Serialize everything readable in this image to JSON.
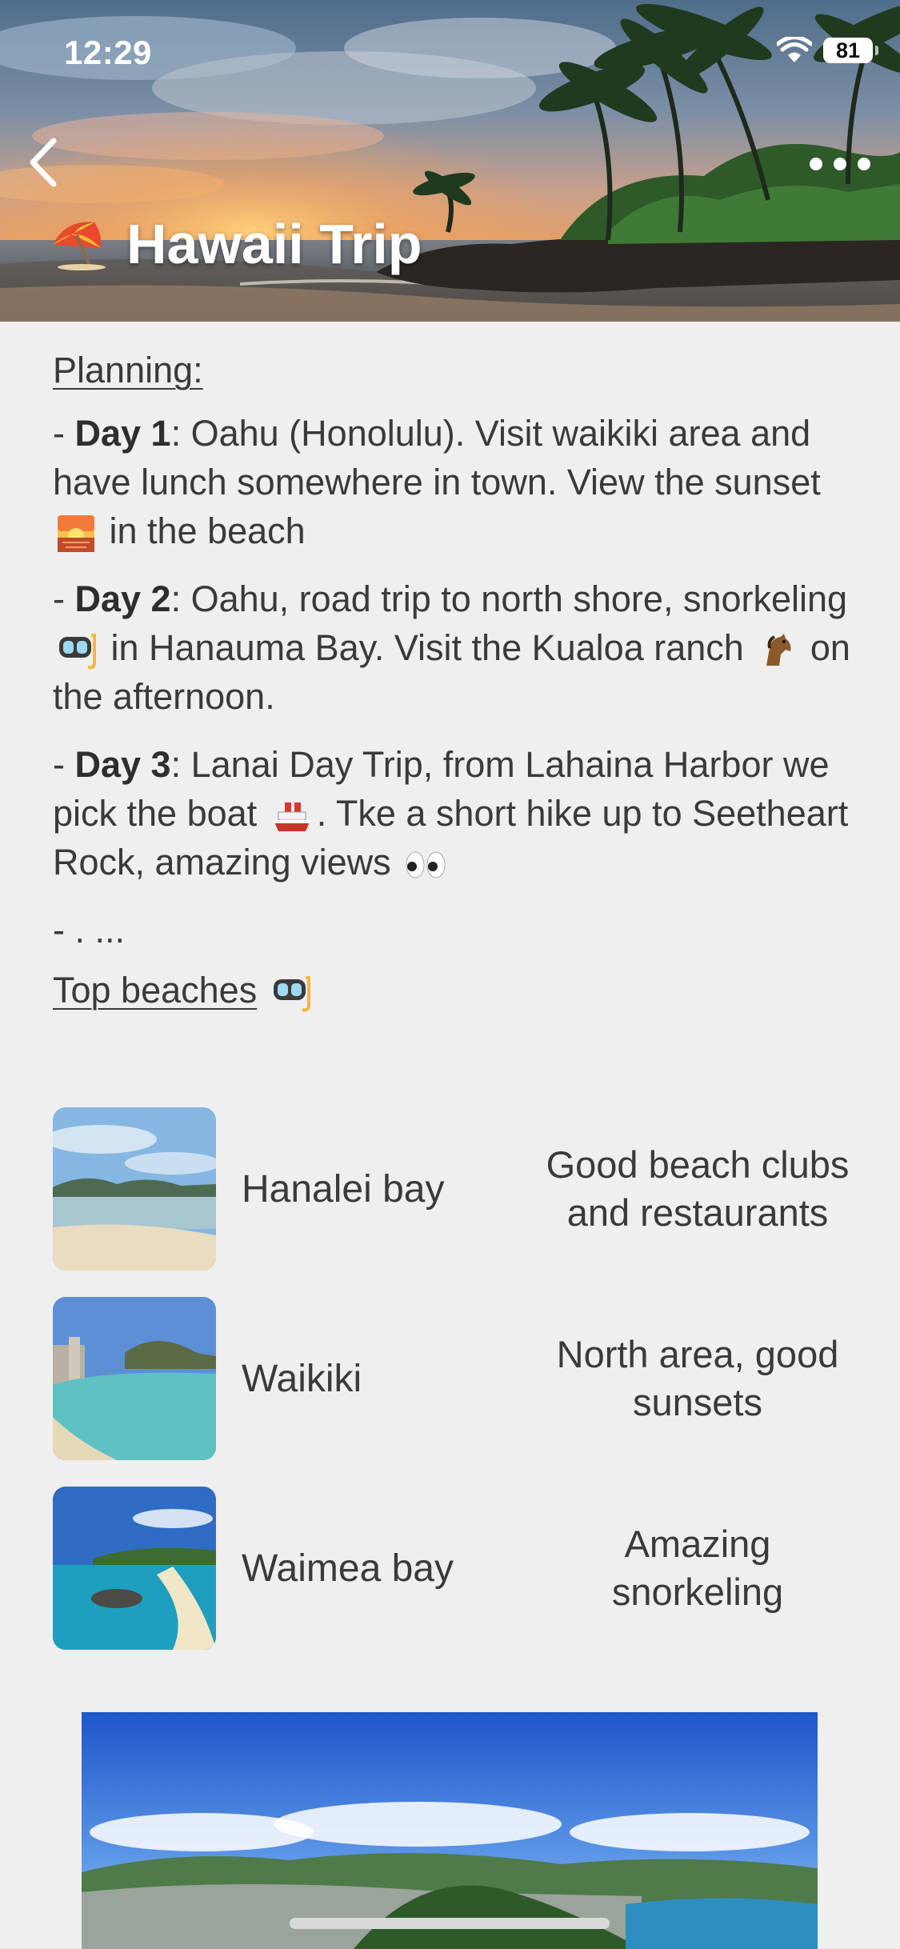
{
  "status_bar": {
    "time": "12:29",
    "battery": "81"
  },
  "header": {
    "title_emoji_icon": "umbrella-on-ground-icon",
    "title": "Hawaii Trip"
  },
  "planning": {
    "heading": "Planning:",
    "days": [
      {
        "prefix": "- ",
        "label": "Day 1",
        "text_a": ": Oahu (Honolulu). Visit waikiki  area and have lunch somewhere in town. View the sunset",
        "emoji_a": "sunset-icon",
        "text_b": " in the beach",
        "emoji_b": "",
        "text_c": ""
      },
      {
        "prefix": "- ",
        "label": "Day 2",
        "text_a": ": Oahu, road trip to north shore, snorkeling",
        "emoji_a": "diving-mask-icon",
        "text_b": " in Hanauma Bay. Visit the Kualoa ranch",
        "emoji_b": "horse-icon",
        "text_c": " on the afternoon."
      },
      {
        "prefix": "- ",
        "label": "Day 3",
        "text_a": ": Lanai Day Trip, from Lahaina Harbor we pick the boat",
        "emoji_a": "ship-icon",
        "text_b": ". Tke a short hike up to Seetheart Rock, amazing views",
        "emoji_b": "eyes-icon",
        "text_c": ""
      }
    ],
    "ellipsis_line": "-  . ..."
  },
  "beaches": {
    "heading": "Top beaches",
    "heading_icon": "diving-mask-icon",
    "rows": [
      {
        "name": "Hanalei bay",
        "note": "Good beach clubs and restaurants"
      },
      {
        "name": "Waikiki",
        "note": "North area, good sunsets"
      },
      {
        "name": "Waimea bay",
        "note": "Amazing snorkeling"
      }
    ]
  },
  "colors": {
    "background": "#efefef",
    "text": "#3a3a3a",
    "title": "#ffffff"
  }
}
